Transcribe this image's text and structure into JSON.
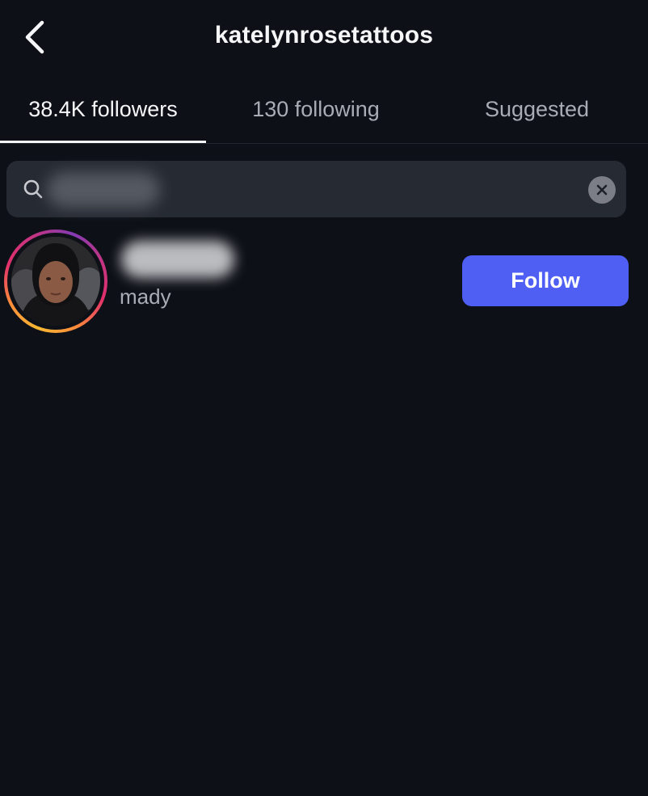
{
  "header": {
    "title": "katelynrosetattoos",
    "back_icon": "chevron-left-icon"
  },
  "tabs": [
    {
      "label": "38.4K followers",
      "active": true
    },
    {
      "label": "130 following",
      "active": false
    },
    {
      "label": "Suggested",
      "active": false
    }
  ],
  "search": {
    "icon": "search-icon",
    "value": "",
    "clear_icon": "close-icon"
  },
  "followers": [
    {
      "username": "",
      "full_name": "mady",
      "button_label": "Follow",
      "story_ring": true
    }
  ],
  "colors": {
    "background": "#0d1017",
    "search_bg": "#262a33",
    "follow_button": "#4f5ef3",
    "text_primary": "#f5f6f8",
    "text_secondary": "#a9acb4"
  }
}
